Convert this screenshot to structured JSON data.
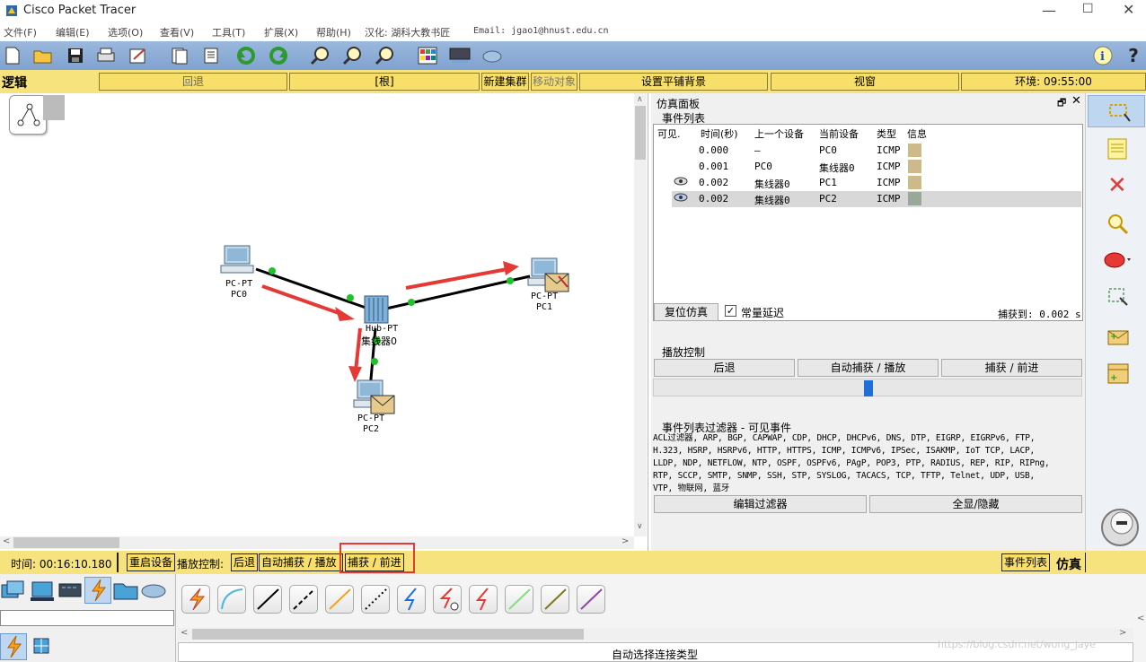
{
  "window": {
    "title": "Cisco Packet Tracer"
  },
  "menu": [
    {
      "label": "文件(F)"
    },
    {
      "label": "编辑(E)"
    },
    {
      "label": "选项(O)"
    },
    {
      "label": "查看(V)"
    },
    {
      "label": "工具(T)"
    },
    {
      "label": "扩展(X)"
    },
    {
      "label": "帮助(H)"
    },
    {
      "label": "汉化: 湖科大教书匠"
    },
    {
      "label": "Email: jgao1@hnust.edu.cn"
    }
  ],
  "modebar": {
    "logic": "逻辑",
    "back": "回退",
    "root": "[根]",
    "new_cluster": "新建集群",
    "move_object": "移动对象",
    "set_tiled_bg": "设置平铺背景",
    "viewport": "视窗",
    "env": "环境: 09:55:00"
  },
  "topology": {
    "devices": [
      {
        "type": "PC-PT",
        "name": "PC0"
      },
      {
        "type": "PC-PT",
        "name": "PC1"
      },
      {
        "type": "PC-PT",
        "name": "PC2"
      },
      {
        "type": "Hub-PT",
        "name": "集线器0"
      }
    ]
  },
  "sim": {
    "panel_title": "仿真面板",
    "event_list_label": "事件列表",
    "columns": [
      "可见.",
      "时间(秒)",
      "上一个设备",
      "当前设备",
      "类型",
      "信息"
    ],
    "events": [
      {
        "time": "0.000",
        "last": "—",
        "current": "PC0",
        "type": "ICMP",
        "color": "#cdb98a",
        "eye": false
      },
      {
        "time": "0.001",
        "last": "PC0",
        "current": "集线器0",
        "type": "ICMP",
        "color": "#cdb98a",
        "eye": false
      },
      {
        "time": "0.002",
        "last": "集线器0",
        "current": "PC1",
        "type": "ICMP",
        "color": "#cdb98a",
        "eye": true
      },
      {
        "time": "0.002",
        "last": "集线器0",
        "current": "PC2",
        "type": "ICMP",
        "color": "#9aa89a",
        "eye": true
      }
    ],
    "reset": "复位仿真",
    "constant_delay": "常量延迟",
    "captured": "捕获到: 0.002 s",
    "playback_label": "播放控制",
    "play_back": "后退",
    "play_auto": "自动捕获 / 播放",
    "play_step": "捕获 / 前进",
    "filter_title": "事件列表过滤器 - 可见事件",
    "filter_lines": [
      "ACL过滤器, ARP, BGP, CAPWAP, CDP, DHCP, DHCPv6, DNS, DTP, EIGRP, EIGRPv6, FTP,",
      "H.323, HSRP, HSRPv6, HTTP, HTTPS, ICMP, ICMPv6, IPSec, ISAKMP, IoT TCP, LACP,",
      "LLDP, NDP, NETFLOW, NTP, OSPF, OSPFv6, PAgP, POP3, PTP, RADIUS, REP, RIP, RIPng,",
      "RTP, SCCP, SMTP, SNMP, SSH, STP, SYSLOG, TACACS, TCP, TFTP, Telnet, UDP, USB,",
      "VTP, 物联网, 蓝牙"
    ],
    "edit_filter": "编辑过滤器",
    "show_hide": "全显/隐藏"
  },
  "status": {
    "time": "时间: 00:16:10.180",
    "power_cycle": "重启设备",
    "play_label": "播放控制:",
    "back": "后退",
    "auto": "自动捕获 / 播放",
    "step": "捕获 / 前进",
    "event_list": "事件列表",
    "mode": "仿真"
  },
  "bottom": {
    "connection_type": "自动选择连接类型",
    "watermark": "https://blog.csdn.net/wong_jaye"
  },
  "colors": {
    "accent_yellow": "#f7e37e",
    "highlight_red": "#e53935",
    "link_green": "#21c12b"
  }
}
